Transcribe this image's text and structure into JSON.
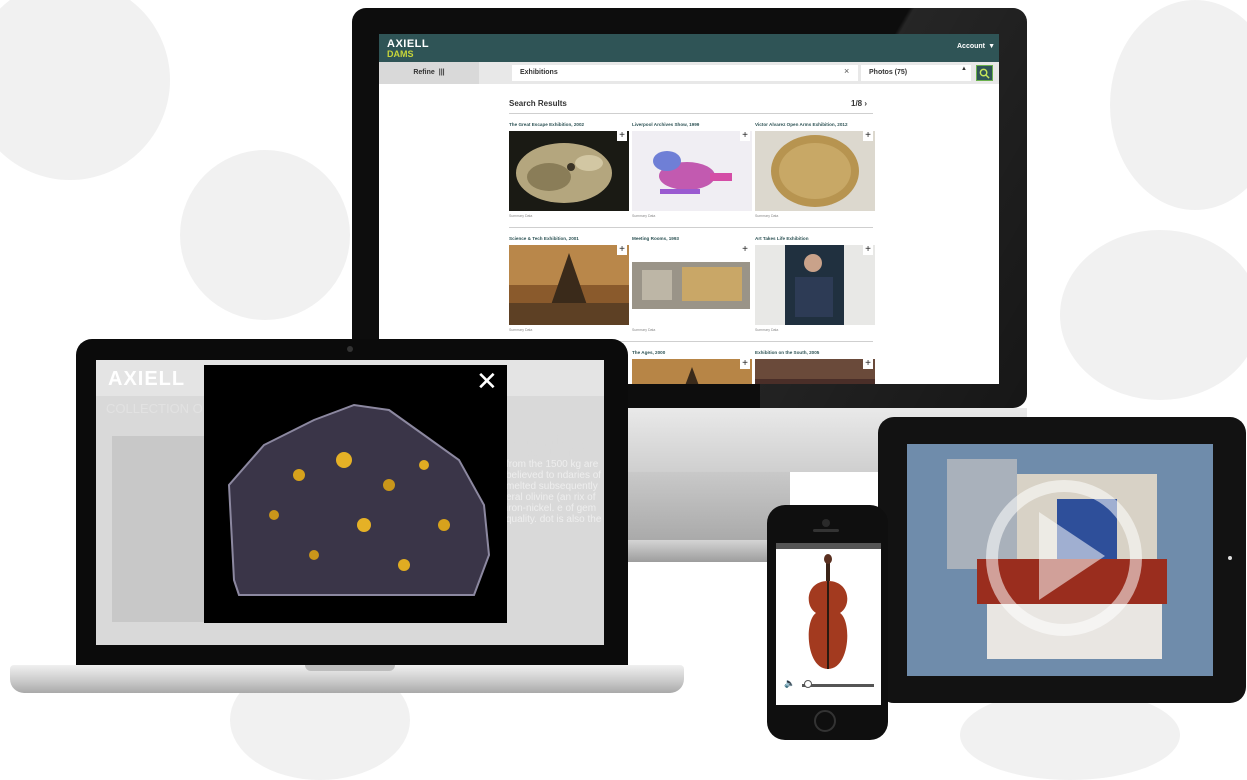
{
  "desktop": {
    "brand_top": "AXIELL",
    "brand_bottom": "DAMS",
    "account_label": "Account",
    "account_caret": "▼",
    "refine_label": "Refine",
    "refine_icon": "|||",
    "search_query": "Exhibitions",
    "clear_icon": "×",
    "photos_filter": "Photos (75)",
    "photos_caret": "▲",
    "search_go_icon": "magnifier-icon",
    "results_title": "Search Results",
    "page_indicator": "1/8 ›",
    "results": [
      {
        "title": "The Great Escape Exhibition, 2002",
        "summary": "Summary Data"
      },
      {
        "title": "Liverpool Archives Show, 1999",
        "summary": "Summary Data"
      },
      {
        "title": "Victor Alvarez Open Arms Exhibition, 2012",
        "summary": "Summary Data"
      },
      {
        "title": "Science & Tech Exhibition, 2001",
        "summary": "Summary Data"
      },
      {
        "title": "Meeting Rooms, 1993",
        "summary": "Summary Data"
      },
      {
        "title": "Art Takes Life Exhibition",
        "summary": "Summary Data"
      },
      {
        "title": "The Ages, 2000",
        "summary": ""
      },
      {
        "title": "Exhibition on the South, 2005",
        "summary": ""
      }
    ],
    "plus_icon": "+"
  },
  "laptop": {
    "logo": "AXIELL",
    "collection_heading": "COLLECTION O",
    "body_heading": "found prior to BM 2001, M16",
    "body_text": "from the 1500 kg are believed to ndaries of melted subsequently eral olivine (an rix of iron-nickel. e of gem quality. dot is also the",
    "close_icon": "✕"
  },
  "tablet": {
    "play_icon": "play-icon"
  },
  "phone": {
    "volume_icon": "🔈",
    "volume_level": 0.05
  },
  "colors": {
    "brand_teal": "#2f5456",
    "brand_lime": "#c7d53a"
  }
}
